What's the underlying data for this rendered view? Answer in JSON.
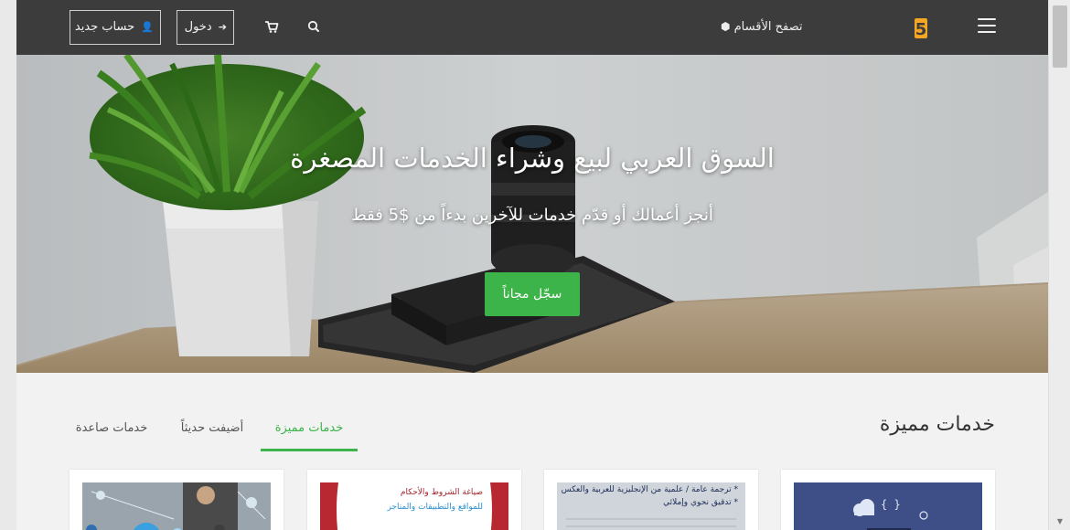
{
  "navbar": {
    "logo_text": "خمسات",
    "browse_label": "تصفح الأقسام",
    "login_label": "دخول",
    "register_label": "حساب جديد"
  },
  "hero": {
    "title": "السوق العربي لبيع وشراء الخدمات المصغرة",
    "subtitle": "أنجز أعمالك أو قدّم خدمات للآخرين بدءاً من $5 فقط",
    "cta_label": "سجّل مجاناً"
  },
  "featured": {
    "title": "خدمات مميزة",
    "tabs": [
      {
        "label": "خدمات مميزة",
        "active": true
      },
      {
        "label": "أضيفت حديثاً",
        "active": false
      },
      {
        "label": "خدمات صاعدة",
        "active": false
      }
    ],
    "cards": [
      {
        "thumb_lines": []
      },
      {
        "thumb_lines": [
          "* ترجمة عامة / علمية من الإنجليزية للعربية والعكس",
          "* تدقيق نحوي وإملائي"
        ]
      },
      {
        "thumb_lines": [
          "صياغة الشروط والأحكام",
          "للمواقع والتطبيقات والمتاجر"
        ]
      },
      {
        "thumb_lines": []
      }
    ]
  },
  "colors": {
    "navbar_bg": "#3c3c3c",
    "accent_green": "#3cb44a",
    "logo_orange": "#f5a623"
  },
  "icons": {
    "menu": "hamburger-icon",
    "browse": "cubes-icon",
    "search": "search-icon",
    "cart": "cart-icon",
    "login": "sign-in-icon",
    "register": "user-plus-icon"
  }
}
